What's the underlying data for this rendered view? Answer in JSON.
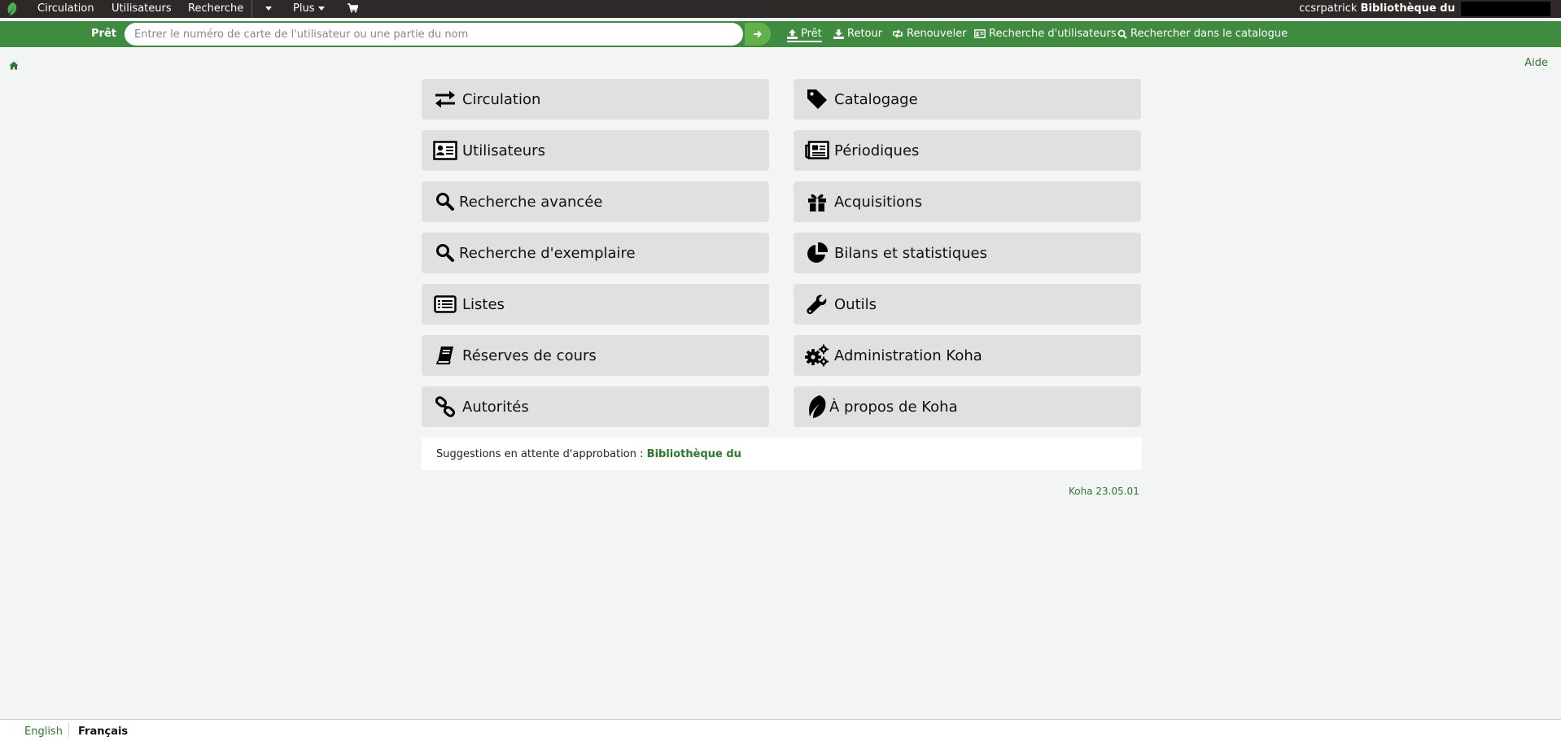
{
  "topnav": {
    "items": [
      "Circulation",
      "Utilisateurs",
      "Recherche",
      "Plus"
    ],
    "user": "ccsrpatrick",
    "library": "Bibliothèque du"
  },
  "header": {
    "tab_label": "Prêt",
    "search_placeholder": "Entrer le numéro de carte de l'utilisateur ou une partie du nom",
    "actions": [
      "Prêt",
      "Retour",
      "Renouveler",
      "Recherche d'utilisateurs",
      "Rechercher dans le catalogue"
    ]
  },
  "help": "Aide",
  "modules": {
    "left": [
      {
        "label": "Circulation",
        "icon": "exchange-icon"
      },
      {
        "label": "Utilisateurs",
        "icon": "id-card-icon"
      },
      {
        "label": "Recherche avancée",
        "icon": "search-icon"
      },
      {
        "label": "Recherche d'exemplaire",
        "icon": "search-icon"
      },
      {
        "label": "Listes",
        "icon": "list-icon"
      },
      {
        "label": "Réserves de cours",
        "icon": "book-icon"
      },
      {
        "label": "Autorités",
        "icon": "link-icon"
      }
    ],
    "right": [
      {
        "label": "Catalogage",
        "icon": "tag-icon"
      },
      {
        "label": "Périodiques",
        "icon": "newspaper-icon"
      },
      {
        "label": "Acquisitions",
        "icon": "gift-icon"
      },
      {
        "label": "Bilans et statistiques",
        "icon": "pie-chart-icon"
      },
      {
        "label": "Outils",
        "icon": "wrench-icon"
      },
      {
        "label": "Administration Koha",
        "icon": "gears-icon"
      },
      {
        "label": "À propos de Koha",
        "icon": "koha-leaf-icon"
      }
    ]
  },
  "suggestions": {
    "text": "Suggestions en attente d'approbation :",
    "library": "Bibliothèque du"
  },
  "version": "Koha 23.05.01",
  "footer": {
    "languages": [
      "English",
      "Français"
    ]
  },
  "colors": {
    "topbar": "#2e2829",
    "header_green": "#3f8b3f",
    "link_green": "#2a7a2a",
    "button_gray": "#e0e0e0"
  }
}
